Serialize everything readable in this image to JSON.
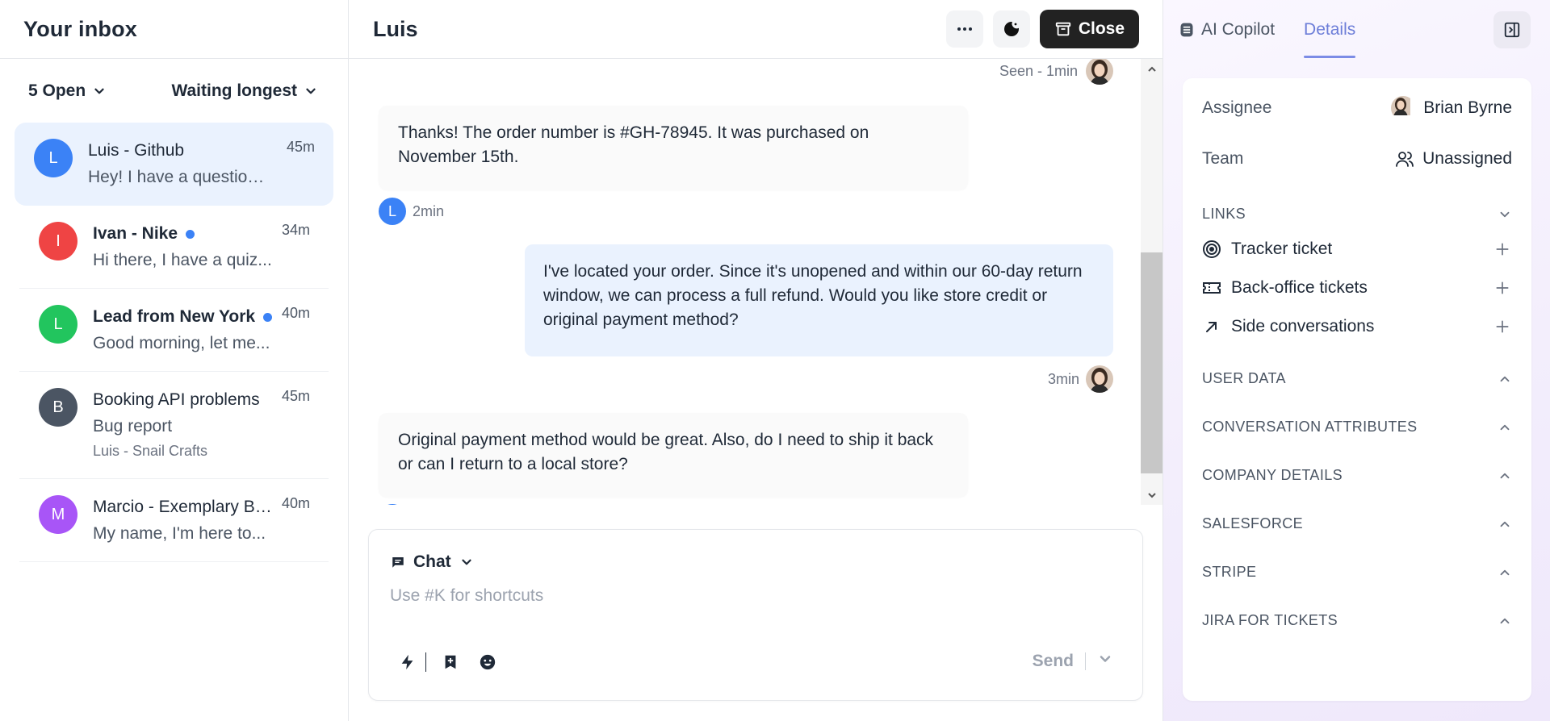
{
  "inbox": {
    "title": "Your inbox",
    "filter_status": "5 Open",
    "filter_sort": "Waiting longest",
    "conversations": [
      {
        "initial": "L",
        "name": "Luis - Github",
        "preview": "Hey! I have a question...",
        "time": "45m",
        "color": "#3b82f6",
        "active": true,
        "unread": false
      },
      {
        "initial": "I",
        "name": "Ivan - Nike",
        "preview": "Hi there, I have a quiz...",
        "time": "34m",
        "color": "#ef4444",
        "unread": true
      },
      {
        "initial": "L",
        "name": "Lead from New York",
        "preview": "Good morning, let me...",
        "time": "40m",
        "color": "#22c55e",
        "unread": true
      },
      {
        "initial": "B",
        "name": "Booking API problems",
        "preview": "Bug report",
        "sub": "Luis - Snail Crafts",
        "time": "45m",
        "color": "#4b5563",
        "unread": false
      },
      {
        "initial": "M",
        "name": "Marcio - Exemplary Bu...",
        "preview": "My name, I'm here to...",
        "time": "40m",
        "color": "#a855f7",
        "unread": false
      }
    ]
  },
  "conversation": {
    "title": "Luis",
    "close_label": "Close",
    "seen_label": "Seen - 1min",
    "messages": [
      {
        "from": "customer",
        "text": "Thanks! The order number is #GH-78945. It was purchased on November 15th.",
        "initial": "L",
        "time": "2min"
      },
      {
        "from": "agent",
        "text": "I've located your order. Since it's unopened and within our 60-day return window, we can process a full refund. Would you like store credit or original payment method?",
        "time": "3min"
      },
      {
        "from": "customer",
        "text": "Original payment method would be great. Also, do I need to ship it back or can I return to a local store?",
        "initial": "L"
      }
    ],
    "composer": {
      "mode": "Chat",
      "placeholder": "Use #K for shortcuts",
      "send_label": "Send"
    }
  },
  "details": {
    "tabs": [
      "AI Copilot",
      "Details"
    ],
    "active_tab": "Details",
    "assignee_label": "Assignee",
    "assignee_value": "Brian Byrne",
    "team_label": "Team",
    "team_value": "Unassigned",
    "links_label": "LINKS",
    "links": [
      "Tracker ticket",
      "Back-office tickets",
      "Side conversations"
    ],
    "sections": [
      "USER DATA",
      "CONVERSATION ATTRIBUTES",
      "COMPANY DETAILS",
      "SALESFORCE",
      "STRIPE",
      "JIRA FOR TICKETS"
    ]
  },
  "colors": {
    "accent": "#3b82f6",
    "active_conv_bg": "#eaf2fe",
    "details_tab_accent": "#6d7ed8",
    "close_button_bg": "#222222"
  }
}
